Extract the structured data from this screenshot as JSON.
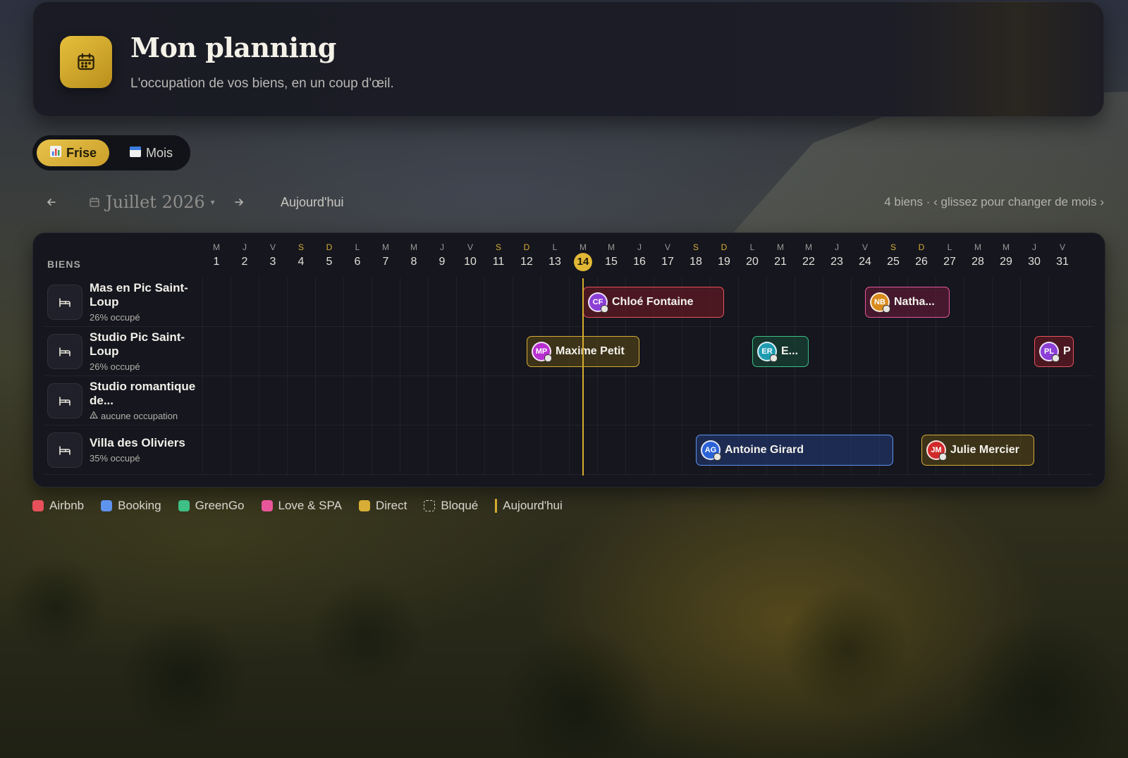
{
  "header": {
    "title": "Mon planning",
    "subtitle": "L'occupation de vos biens, en un coup d'œil.",
    "icon": "calendar-icon"
  },
  "view_toggle": {
    "frise_label": "Frise",
    "mois_label": "Mois",
    "active": "Frise"
  },
  "nav": {
    "month_label": "Juillet 2026",
    "today_label": "Aujourd'hui",
    "hint": "4 biens · ‹ glissez pour changer de mois ›"
  },
  "calendar": {
    "column_header": "BIENS",
    "today": 14,
    "days": [
      {
        "l": "M",
        "n": "1"
      },
      {
        "l": "J",
        "n": "2"
      },
      {
        "l": "V",
        "n": "3"
      },
      {
        "l": "S",
        "n": "4"
      },
      {
        "l": "D",
        "n": "5"
      },
      {
        "l": "L",
        "n": "6"
      },
      {
        "l": "M",
        "n": "7"
      },
      {
        "l": "M",
        "n": "8"
      },
      {
        "l": "J",
        "n": "9"
      },
      {
        "l": "V",
        "n": "10"
      },
      {
        "l": "S",
        "n": "11"
      },
      {
        "l": "D",
        "n": "12"
      },
      {
        "l": "L",
        "n": "13"
      },
      {
        "l": "M",
        "n": "14"
      },
      {
        "l": "M",
        "n": "15"
      },
      {
        "l": "J",
        "n": "16"
      },
      {
        "l": "V",
        "n": "17"
      },
      {
        "l": "S",
        "n": "18"
      },
      {
        "l": "D",
        "n": "19"
      },
      {
        "l": "L",
        "n": "20"
      },
      {
        "l": "M",
        "n": "21"
      },
      {
        "l": "M",
        "n": "22"
      },
      {
        "l": "J",
        "n": "23"
      },
      {
        "l": "V",
        "n": "24"
      },
      {
        "l": "S",
        "n": "25"
      },
      {
        "l": "D",
        "n": "26"
      },
      {
        "l": "L",
        "n": "27"
      },
      {
        "l": "M",
        "n": "28"
      },
      {
        "l": "M",
        "n": "29"
      },
      {
        "l": "J",
        "n": "30"
      },
      {
        "l": "V",
        "n": "31"
      }
    ],
    "properties": [
      {
        "name": "Mas en Pic Saint-Loup",
        "occupancy": "26% occupé",
        "warning": false,
        "bookings": [
          {
            "initials": "CF",
            "guest": "Chloé Fontaine",
            "channel": "airbnb",
            "start": 14.0,
            "end": 19.0,
            "avatar_color": "#8b3fd6"
          },
          {
            "initials": "NB",
            "guest": "Natha...",
            "channel": "love",
            "start": 24.0,
            "end": 27.0,
            "avatar_color": "#d98a1c"
          }
        ]
      },
      {
        "name": "Studio Pic Saint-Loup",
        "occupancy": "26% occupé",
        "warning": false,
        "bookings": [
          {
            "initials": "MP",
            "guest": "Maxime Petit",
            "channel": "direct",
            "start": 12.0,
            "end": 16.0,
            "avatar_color": "#b72fd0"
          },
          {
            "initials": "ER",
            "guest": "E...",
            "channel": "greengo",
            "start": 20.0,
            "end": 22.0,
            "avatar_color": "#1f9bb0"
          },
          {
            "initials": "PL",
            "guest": "P",
            "channel": "airbnb",
            "start": 30.0,
            "end": 31.4,
            "avatar_color": "#8b3fd6"
          }
        ]
      },
      {
        "name": "Studio romantique de...",
        "occupancy": "aucune occupation",
        "warning": true,
        "bookings": []
      },
      {
        "name": "Villa des Oliviers",
        "occupancy": "35% occupé",
        "warning": false,
        "bookings": [
          {
            "initials": "AG",
            "guest": "Antoine Girard",
            "channel": "booking",
            "start": 18.0,
            "end": 25.0,
            "avatar_color": "#2c62d8"
          },
          {
            "initials": "JM",
            "guest": "Julie Mercier",
            "channel": "direct",
            "start": 26.0,
            "end": 30.0,
            "avatar_color": "#d02a2a"
          }
        ]
      }
    ]
  },
  "legend": [
    {
      "label": "Airbnb",
      "type": "color",
      "color": "#e8515b"
    },
    {
      "label": "Booking",
      "type": "color",
      "color": "#5e93ee"
    },
    {
      "label": "GreenGo",
      "type": "color",
      "color": "#3ebf86"
    },
    {
      "label": "Love & SPA",
      "type": "color",
      "color": "#e8569a"
    },
    {
      "label": "Direct",
      "type": "color",
      "color": "#d7ad35"
    },
    {
      "label": "Bloqué",
      "type": "blocked"
    },
    {
      "label": "Aujourd'hui",
      "type": "today"
    }
  ]
}
